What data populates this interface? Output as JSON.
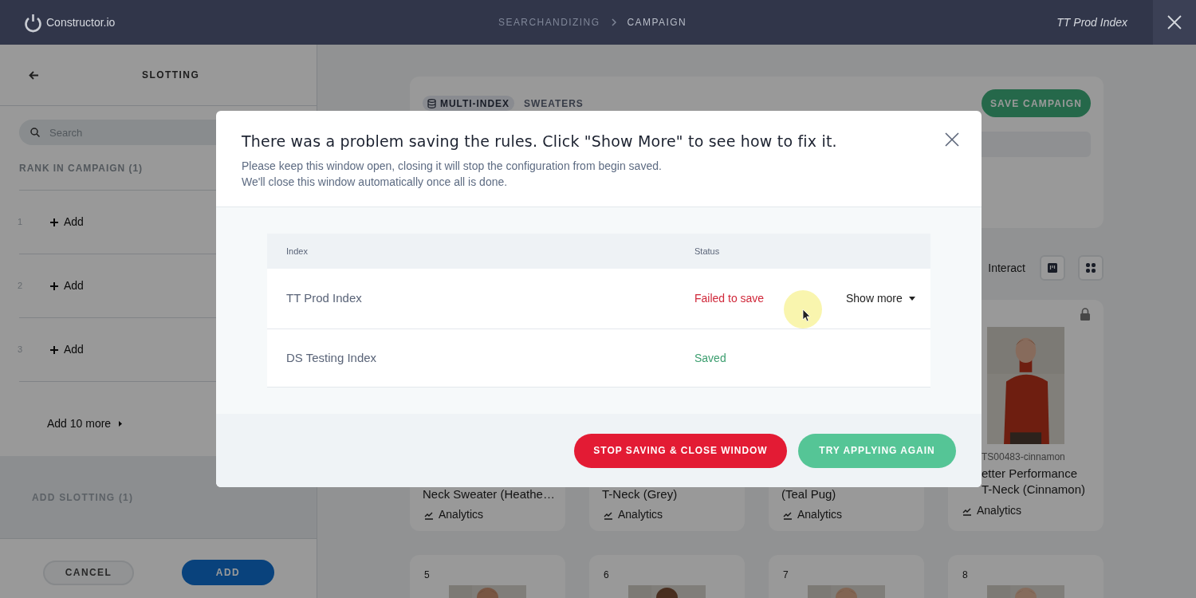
{
  "header": {
    "logo": "Constructor.io",
    "breadcrumb": [
      "SEARCHANDIZING",
      "CAMPAIGN"
    ],
    "index_name": "TT Prod Index"
  },
  "sidebar": {
    "title": "SLOTTING",
    "search": {
      "placeholder": "Search"
    },
    "section_label": "RANK IN CAMPAIGN (1)",
    "slots": [
      {
        "number": "1",
        "label": "Add"
      },
      {
        "number": "2",
        "label": "Add"
      },
      {
        "number": "3",
        "label": "Add"
      }
    ],
    "add_more": "Add 10 more",
    "add_slotting": "ADD SLOTTING (1)",
    "cancel": "CANCEL",
    "add": "ADD"
  },
  "campaign": {
    "chip": "MULTI-INDEX",
    "category": "SWEATERS",
    "save": "SAVE CAMPAIGN"
  },
  "toolbar": {
    "interact": "Interact"
  },
  "cards": [
    {
      "title": "Neck Sweater (Heathe…",
      "analytics": "Analytics"
    },
    {
      "title": "T-Neck (Grey)",
      "analytics": "Analytics"
    },
    {
      "title": "(Teal Pug)",
      "analytics": "Analytics"
    },
    {
      "locked": true,
      "picture": true,
      "code": "TS00483-cinnamon",
      "title_lines": [
        "etter Performance",
        "T-Neck (Cinnamon)"
      ],
      "analytics": "Analytics"
    }
  ],
  "cards_row2": [
    {
      "number": "5"
    },
    {
      "number": "6"
    },
    {
      "number": "7"
    },
    {
      "number": "8"
    }
  ],
  "dialog": {
    "title": "There was a problem saving the rules. Click \"Show More\" to see how to fix it.",
    "message": [
      "Please keep this window open, closing it will stop the configuration from begin saved.",
      "We'll close this window automatically once all is done."
    ],
    "columns": [
      "Index",
      "Status"
    ],
    "rows": [
      {
        "index": "TT Prod Index",
        "status": "Failed to save",
        "kind": "failed",
        "action": "Show more"
      },
      {
        "index": "DS Testing Index",
        "status": "Saved",
        "kind": "saved"
      }
    ],
    "stop_button": "STOP SAVING & CLOSE WINDOW",
    "retry_button": "TRY APPLYING AGAIN"
  }
}
